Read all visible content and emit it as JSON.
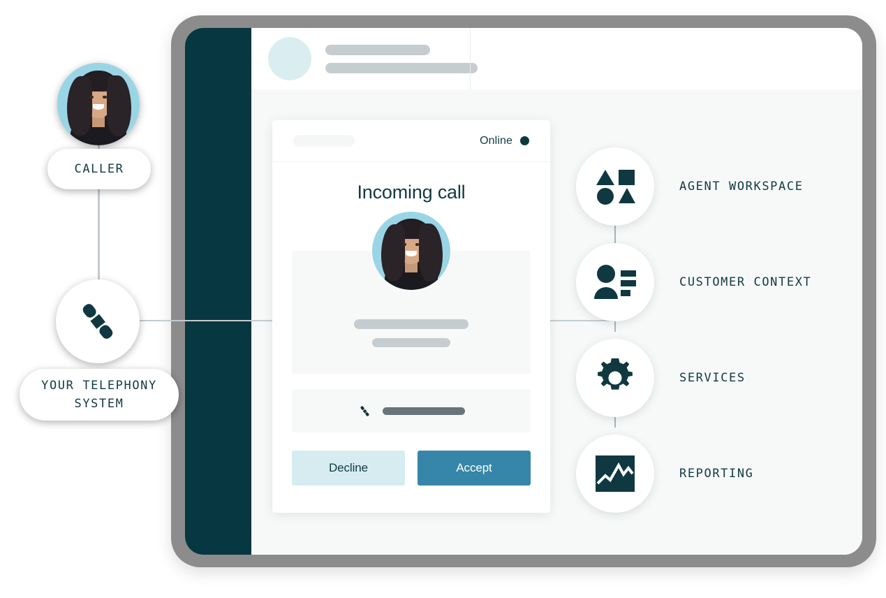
{
  "app": {
    "sidebar": {
      "icon": "sidebar-placeholder"
    },
    "topbar": {
      "avatar_icon": "user-avatar-placeholder",
      "skeleton_line_1": "",
      "skeleton_line_2": ""
    }
  },
  "call_card": {
    "header_skeleton": "",
    "status_label": "Online",
    "status_icon": "status-dot-icon",
    "title": "Incoming call",
    "caller_photo_icon": "caller-portrait",
    "detail_skeleton_1": "",
    "detail_skeleton_2": "",
    "phone_icon": "phone-handset-icon",
    "phone_number_skeleton": "",
    "decline_label": "Decline",
    "accept_label": "Accept"
  },
  "features": [
    {
      "label": "AGENT WORKSPACE",
      "icon": "shapes-grid-icon"
    },
    {
      "label": "CUSTOMER CONTEXT",
      "icon": "person-details-icon"
    },
    {
      "label": "SERVICES",
      "icon": "gear-icon"
    },
    {
      "label": "REPORTING",
      "icon": "line-chart-icon"
    }
  ],
  "left_nodes": {
    "caller": {
      "label": "CALLER",
      "icon": "caller-avatar-photo"
    },
    "telephony": {
      "label": "YOUR TELEPHONY SYSTEM",
      "icon": "phone-handset-icon"
    }
  },
  "colors": {
    "sidebar_dark_teal": "#073740",
    "accent_teal": "#3586A8",
    "decline_light_blue": "#D6ECF1",
    "text_dark": "#123A42",
    "avatar_blue": "#9AD5E6",
    "frame_gray": "#8C8C8C",
    "skeleton_gray": "#C6CDD1",
    "connector_gray": "#C3CBCF"
  }
}
